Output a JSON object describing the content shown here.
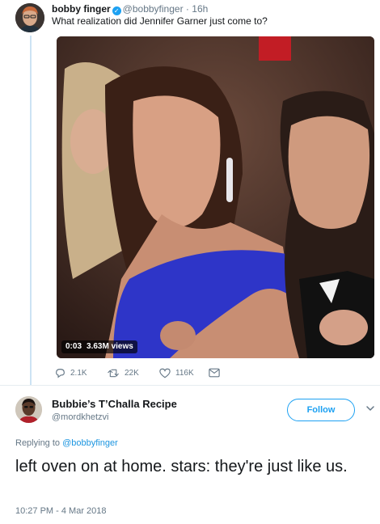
{
  "parent_tweet": {
    "author_name": "bobby finger",
    "handle": "@bobbyfinger",
    "separator": "·",
    "time": "16h",
    "text": "What realization did Jennifer Garner just come to?",
    "media": {
      "duration": "0:03",
      "views": "3.63M views"
    },
    "actions": {
      "reply_count": "2.1K",
      "retweet_count": "22K",
      "like_count": "116K"
    }
  },
  "reply_tweet": {
    "author_name": "Bubbie’s T’Challa Recipe",
    "handle": "@mordkhetzvi",
    "follow_label": "Follow",
    "replying_prefix": "Replying to",
    "replying_to": "@bobbyfinger",
    "text": "left oven on at home. stars: they're just like us.",
    "timestamp": "10:27 PM - 4 Mar 2018"
  },
  "colors": {
    "accent": "#1da1f2",
    "secondary_text": "#657786",
    "thread_line": "#cce3f4"
  },
  "icons": {
    "verified": "verified-badge-icon",
    "reply": "reply-icon",
    "retweet": "retweet-icon",
    "like": "heart-icon",
    "dm": "envelope-icon",
    "more": "chevron-down-icon"
  }
}
